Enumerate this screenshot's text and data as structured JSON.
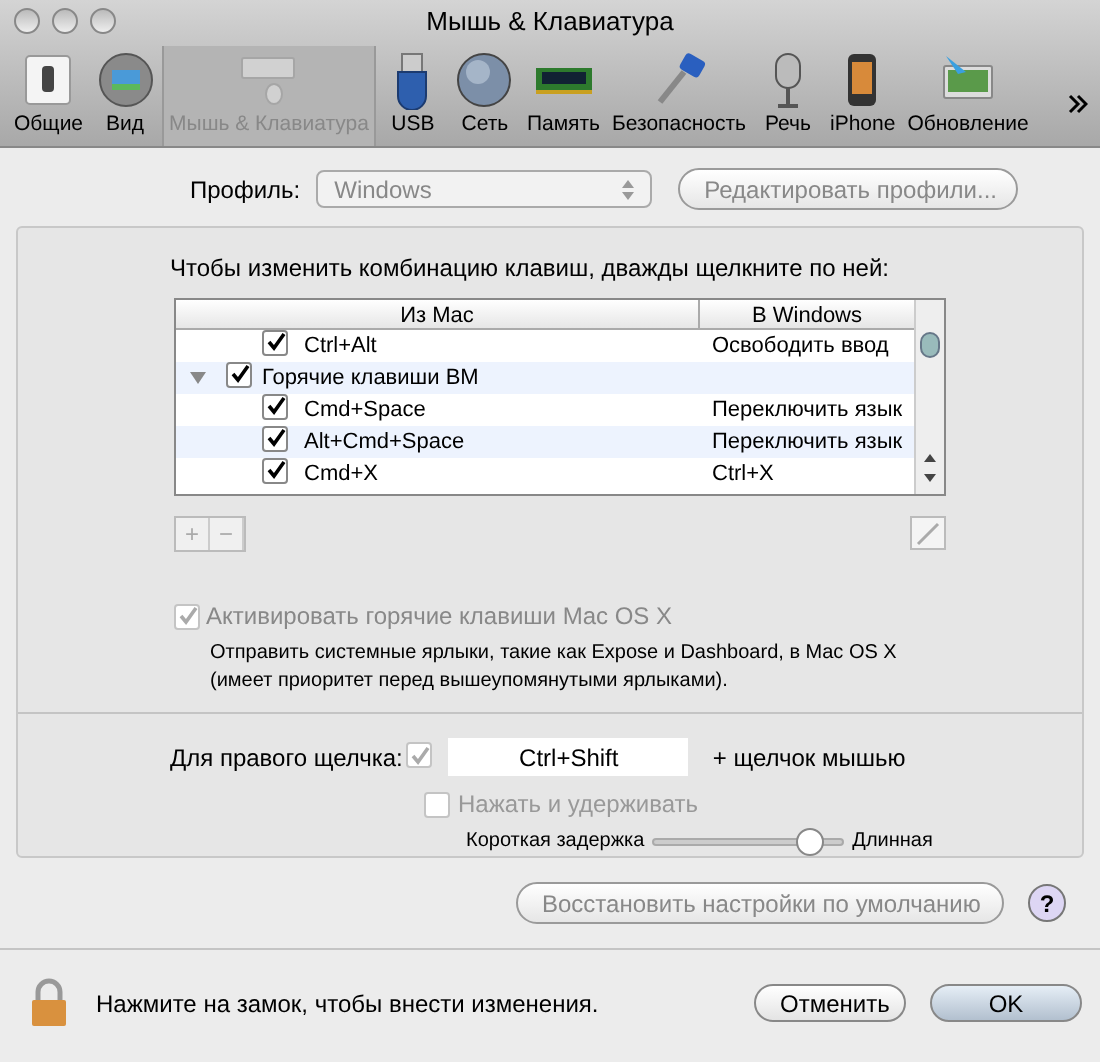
{
  "window": {
    "title": "Мышь & Клавиатура"
  },
  "toolbar": [
    {
      "label": "Общие",
      "selected": false
    },
    {
      "label": "Вид",
      "selected": false
    },
    {
      "label": "Мышь & Клавиатура",
      "selected": true
    },
    {
      "label": "USB",
      "selected": false
    },
    {
      "label": "Сеть",
      "selected": false
    },
    {
      "label": "Память",
      "selected": false
    },
    {
      "label": "Безопасность",
      "selected": false
    },
    {
      "label": "Речь",
      "selected": false
    },
    {
      "label": "iPhone",
      "selected": false
    },
    {
      "label": "Обновление",
      "selected": false
    }
  ],
  "profile": {
    "label": "Профиль:",
    "value": "Windows",
    "edit_button": "Редактировать профили..."
  },
  "instructions": "Чтобы изменить комбинацию клавиш, дважды щелкните по ней:",
  "table": {
    "columns": [
      "Из Mac",
      "В Windows"
    ],
    "rows": [
      {
        "kind": "shortcut",
        "checked": true,
        "from": "Ctrl+Alt",
        "to": "Освободить ввод"
      },
      {
        "kind": "group",
        "checked": true,
        "expanded": true,
        "from": "Горячие клавиши ВМ",
        "children": [
          {
            "kind": "shortcut",
            "checked": true,
            "from": "Cmd+Space",
            "to": "Переключить язык"
          },
          {
            "kind": "shortcut",
            "checked": true,
            "from": "Alt+Cmd+Space",
            "to": "Переключить язык"
          },
          {
            "kind": "shortcut",
            "checked": true,
            "from": "Cmd+X",
            "to": "Ctrl+X"
          }
        ]
      }
    ]
  },
  "table_buttons": [
    "+",
    "−"
  ],
  "mac_hotkeys": {
    "label": "Активировать горячие клавиши Mac OS X",
    "checked": true,
    "disabled": true,
    "description": "Отправить системные ярлыки, такие как Expose и Dashboard, в Mac OS X (имеет приоритет перед вышеупомянутыми ярлыками)."
  },
  "right_click": {
    "label": "Для правого щелчка:",
    "checked": true,
    "disabled": true,
    "value": "Ctrl+Shift",
    "suffix": "+ щелчок мышью"
  },
  "press_hold": {
    "label": "Нажать и удерживать",
    "checked": false,
    "disabled": true
  },
  "delay": {
    "min_label": "Короткая задержка",
    "max_label": "Длинная",
    "level": 0.88
  },
  "restore_button": "Восстановить настройки по умолчанию",
  "help": "?",
  "lock_text": "Нажмите на замок, чтобы внести изменения.",
  "buttons": [
    {
      "label": "Отменить",
      "kind": "secondary"
    },
    {
      "label": "OK",
      "kind": "default"
    }
  ]
}
